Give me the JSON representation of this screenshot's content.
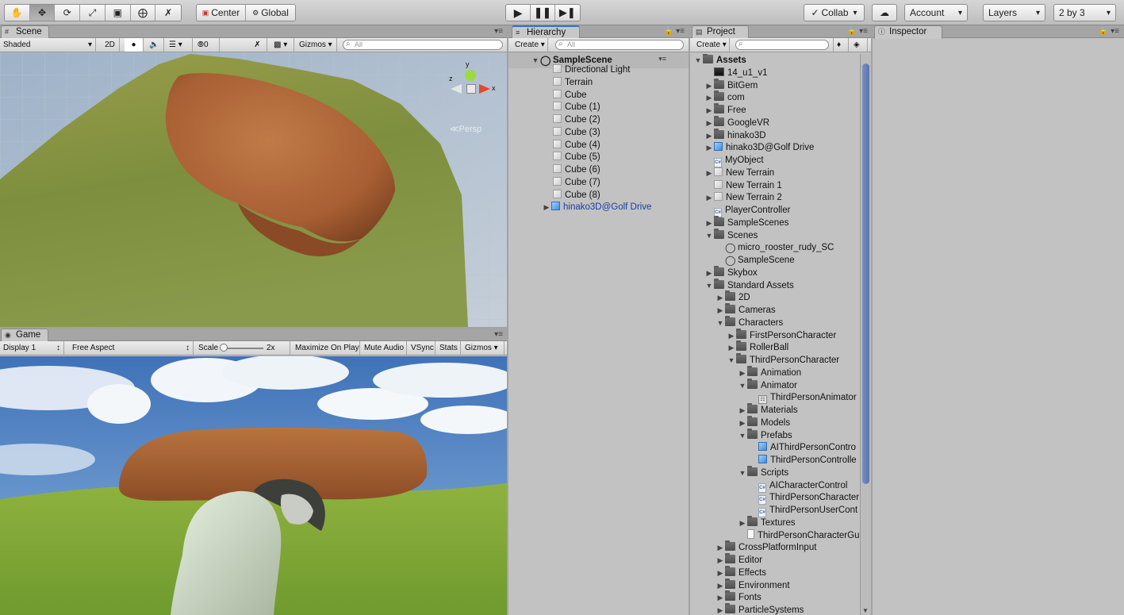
{
  "toolbar": {
    "pivot_label": "Center",
    "space_label": "Global",
    "collab_label": "Collab",
    "account_label": "Account",
    "layers_label": "Layers",
    "layout_label": "2 by 3"
  },
  "scene": {
    "tab": "Scene",
    "shading": "Shaded",
    "mode_2d": "2D",
    "hidden_count": "0",
    "gizmos": "Gizmos",
    "search_placeholder": "All",
    "persp": "Persp",
    "axis_x": "x",
    "axis_y": "y",
    "axis_z": "z"
  },
  "game": {
    "tab": "Game",
    "display": "Display 1",
    "aspect": "Free Aspect",
    "scale_label": "Scale",
    "scale_value": "2x",
    "maximize": "Maximize On Play",
    "mute": "Mute Audio",
    "vsync": "VSync",
    "stats": "Stats",
    "gizmos": "Gizmos"
  },
  "hierarchy": {
    "tab": "Hierarchy",
    "create": "Create",
    "search_placeholder": "All",
    "scene_name": "SampleScene",
    "items": [
      "Directional Light",
      "Terrain",
      "Cube",
      "Cube (1)",
      "Cube (2)",
      "Cube (3)",
      "Cube (4)",
      "Cube (5)",
      "Cube (6)",
      "Cube (7)",
      "Cube (8)"
    ],
    "prefab_item": "hinako3D@Golf Drive"
  },
  "project": {
    "tab": "Project",
    "create": "Create",
    "rows": [
      {
        "label": "Assets",
        "depth": 0,
        "arrow": "open",
        "icon": "folder",
        "bold": true
      },
      {
        "label": "14_u1_v1",
        "depth": 1,
        "arrow": "",
        "icon": "img"
      },
      {
        "label": "BitGem",
        "depth": 1,
        "arrow": "closed",
        "icon": "folder"
      },
      {
        "label": "com",
        "depth": 1,
        "arrow": "closed",
        "icon": "folder"
      },
      {
        "label": "Free",
        "depth": 1,
        "arrow": "closed",
        "icon": "folder"
      },
      {
        "label": "GoogleVR",
        "depth": 1,
        "arrow": "closed",
        "icon": "folder"
      },
      {
        "label": "hinako3D",
        "depth": 1,
        "arrow": "closed",
        "icon": "folder"
      },
      {
        "label": "hinako3D@Golf Drive",
        "depth": 1,
        "arrow": "closed",
        "icon": "prefab"
      },
      {
        "label": "MyObject",
        "depth": 1,
        "arrow": "",
        "icon": "script"
      },
      {
        "label": "New Terrain",
        "depth": 1,
        "arrow": "closed",
        "icon": "cube"
      },
      {
        "label": "New Terrain 1",
        "depth": 1,
        "arrow": "",
        "icon": "cube"
      },
      {
        "label": "New Terrain 2",
        "depth": 1,
        "arrow": "closed",
        "icon": "cube"
      },
      {
        "label": "PlayerController",
        "depth": 1,
        "arrow": "",
        "icon": "script"
      },
      {
        "label": "SampleScenes",
        "depth": 1,
        "arrow": "closed",
        "icon": "folder"
      },
      {
        "label": "Scenes",
        "depth": 1,
        "arrow": "open",
        "icon": "folder"
      },
      {
        "label": "micro_rooster_rudy_SC",
        "depth": 2,
        "arrow": "",
        "icon": "unity"
      },
      {
        "label": "SampleScene",
        "depth": 2,
        "arrow": "",
        "icon": "unity"
      },
      {
        "label": "Skybox",
        "depth": 1,
        "arrow": "closed",
        "icon": "folder"
      },
      {
        "label": "Standard Assets",
        "depth": 1,
        "arrow": "open",
        "icon": "folder"
      },
      {
        "label": "2D",
        "depth": 2,
        "arrow": "closed",
        "icon": "folder"
      },
      {
        "label": "Cameras",
        "depth": 2,
        "arrow": "closed",
        "icon": "folder"
      },
      {
        "label": "Characters",
        "depth": 2,
        "arrow": "open",
        "icon": "folder"
      },
      {
        "label": "FirstPersonCharacter",
        "depth": 3,
        "arrow": "closed",
        "icon": "folder"
      },
      {
        "label": "RollerBall",
        "depth": 3,
        "arrow": "closed",
        "icon": "folder"
      },
      {
        "label": "ThirdPersonCharacter",
        "depth": 3,
        "arrow": "open",
        "icon": "folder"
      },
      {
        "label": "Animation",
        "depth": 4,
        "arrow": "closed",
        "icon": "folder"
      },
      {
        "label": "Animator",
        "depth": 4,
        "arrow": "open",
        "icon": "folder"
      },
      {
        "label": "ThirdPersonAnimator",
        "depth": 5,
        "arrow": "",
        "icon": "anim"
      },
      {
        "label": "Materials",
        "depth": 4,
        "arrow": "closed",
        "icon": "folder"
      },
      {
        "label": "Models",
        "depth": 4,
        "arrow": "closed",
        "icon": "folder"
      },
      {
        "label": "Prefabs",
        "depth": 4,
        "arrow": "open",
        "icon": "folder"
      },
      {
        "label": "AIThirdPersonContro",
        "depth": 5,
        "arrow": "",
        "icon": "prefab"
      },
      {
        "label": "ThirdPersonControlle",
        "depth": 5,
        "arrow": "",
        "icon": "prefab"
      },
      {
        "label": "Scripts",
        "depth": 4,
        "arrow": "open",
        "icon": "folder"
      },
      {
        "label": "AICharacterControl",
        "depth": 5,
        "arrow": "",
        "icon": "script"
      },
      {
        "label": "ThirdPersonCharacter",
        "depth": 5,
        "arrow": "",
        "icon": "script"
      },
      {
        "label": "ThirdPersonUserCont",
        "depth": 5,
        "arrow": "",
        "icon": "script"
      },
      {
        "label": "Textures",
        "depth": 4,
        "arrow": "closed",
        "icon": "folder"
      },
      {
        "label": "ThirdPersonCharacterGu",
        "depth": 4,
        "arrow": "",
        "icon": "doc"
      },
      {
        "label": "CrossPlatformInput",
        "depth": 2,
        "arrow": "closed",
        "icon": "folder"
      },
      {
        "label": "Editor",
        "depth": 2,
        "arrow": "closed",
        "icon": "folder"
      },
      {
        "label": "Effects",
        "depth": 2,
        "arrow": "closed",
        "icon": "folder"
      },
      {
        "label": "Environment",
        "depth": 2,
        "arrow": "closed",
        "icon": "folder"
      },
      {
        "label": "Fonts",
        "depth": 2,
        "arrow": "closed",
        "icon": "folder"
      },
      {
        "label": "ParticleSystems",
        "depth": 2,
        "arrow": "closed",
        "icon": "folder"
      }
    ]
  },
  "inspector": {
    "tab": "Inspector"
  }
}
